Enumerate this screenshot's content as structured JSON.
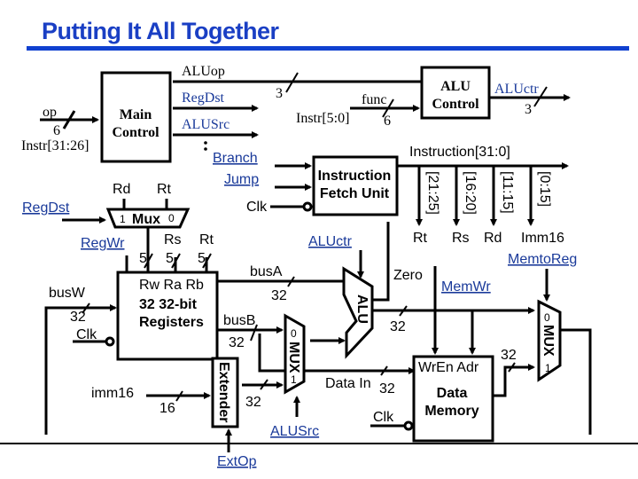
{
  "title": "Putting It All Together",
  "colors": {
    "title": "#1a3fc4",
    "control_signal": "#1a3a9a"
  },
  "main_control": {
    "label_line1": "Main",
    "label_line2": "Control",
    "input_label": "op",
    "input_width": "6",
    "input_source": "Instr[31:26]",
    "outputs": {
      "aluop": "ALUop",
      "aluop_width": "3",
      "regdst": "RegDst",
      "alusrc": "ALUSrc",
      "ellipsis": ":"
    }
  },
  "alu_control": {
    "label_line1": "ALU",
    "label_line2": "Control",
    "func_label": "func",
    "func_width": "6",
    "func_source": "Instr[5:0]",
    "output_label": "ALUctr",
    "output_width": "3"
  },
  "ifu": {
    "label_line1": "Instruction",
    "label_line2": "Fetch Unit",
    "branch": "Branch",
    "jump": "Jump",
    "clk": "Clk",
    "output": "Instruction[31:0]",
    "fields": [
      "[21:25]",
      "[16:20]",
      "[11:15]",
      "[0:15]"
    ],
    "field_names": [
      "Rt",
      "Rs",
      "Rd",
      "Imm16"
    ]
  },
  "regdst_mux": {
    "label": "Mux",
    "in1": "1",
    "in0": "0",
    "rd": "Rd",
    "rt": "Rt",
    "control": "RegDst"
  },
  "register_file": {
    "line1": "Rw  Ra  Rb",
    "line2": "32 32-bit",
    "line3": "Registers",
    "regwr": "RegWr",
    "rs": "Rs",
    "rt": "Rt",
    "width5": "5",
    "busW": "busW",
    "busA": "busA",
    "busB": "busB",
    "width32": "32",
    "clk": "Clk"
  },
  "extender": {
    "label": "Extender",
    "input": "imm16",
    "input_width": "16",
    "output_width": "32",
    "control": "ExtOp"
  },
  "alusrc_mux": {
    "label": "MUX",
    "in0": "0",
    "in1": "1",
    "control": "ALUSrc"
  },
  "alu": {
    "label": "ALU",
    "control": "ALUctr",
    "zero": "Zero",
    "out_width": "32"
  },
  "data_memory": {
    "line1": "Data",
    "line2": "Memory",
    "ports": "WrEn Adr",
    "data_in": "Data In",
    "data_in_width": "32",
    "clk": "Clk",
    "control": "MemWr",
    "out_width": "32"
  },
  "memtoreg_mux": {
    "label": "MUX",
    "in0": "0",
    "in1": "1",
    "control": "MemtoReg"
  }
}
